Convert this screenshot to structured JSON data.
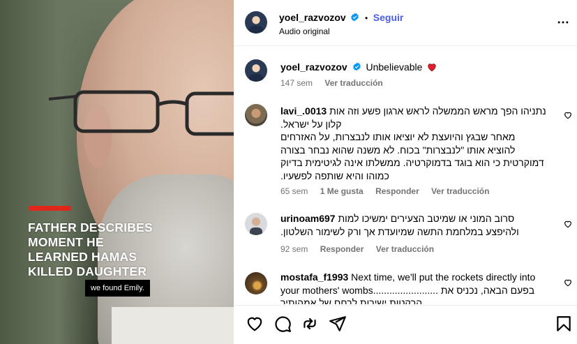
{
  "video": {
    "headline_lines": [
      "FATHER DESCRIBES",
      "MOMENT HE",
      "LEARNED HAMAS",
      "KILLED DAUGHTER"
    ],
    "caption": "we found Emily.",
    "accent_color": "#e1261c"
  },
  "header": {
    "username": "yoel_razvozov",
    "follow_label": "Seguir",
    "separator": "•",
    "subtitle": "Audio original",
    "more_icon": "more-horizontal-icon"
  },
  "post": {
    "username": "yoel_razvozov",
    "text": "Unbelievable",
    "emoji_icon": "red-heart-icon",
    "time": "147 sem",
    "translate_label": "Ver traducción"
  },
  "comments": [
    {
      "username": "lavi_.0013",
      "lines": [
        "נתניהו הפך מראש הממשלה לראש ארגון פשע וזה אות",
        "קלון על ישראל.",
        "מאחר שבגץ והיועצת לא יוציאו אותו לנבצרות, על האזרחים",
        "להוציא אותו \"לנבצרות\" בכוח. לא משנה שהוא נבחר בצורה",
        "דמוקרטית כי הוא בוגד בדמוקרטיה. ממשלתו אינה לגיטימית בדיוק",
        "כמוהו והיא שותפה לפשעיו."
      ],
      "time": "65 sem",
      "likes": "1 Me gusta",
      "reply_label": "Responder",
      "translate_label": "Ver traducción"
    },
    {
      "username": "urinoam697",
      "lines": [
        "סרוב המוני או שמיטב הצעירים ימשיכו למות",
        "ולהיפצע במלחמת התשה שמיועדת אך ורק לשימור השלטון."
      ],
      "time": "92 sem",
      "reply_label": "Responder",
      "translate_label": "Ver traducción"
    },
    {
      "username": "mostafa_f1993",
      "lines": [
        "Next time, we'll put the rockets directly into",
        "your mothers' wombs........................ בפעם הבאה, נכניס את",
        "הרקטות ישירות לרחם של אמהותיך"
      ]
    }
  ],
  "actions": {
    "like_icon": "heart-icon",
    "comment_icon": "comment-icon",
    "repost_icon": "repost-icon",
    "share_icon": "share-icon",
    "save_icon": "bookmark-icon"
  },
  "colors": {
    "link": "#4a5de3",
    "verified": "#0095f6",
    "muted": "#737373",
    "heart": "#ed4956"
  }
}
